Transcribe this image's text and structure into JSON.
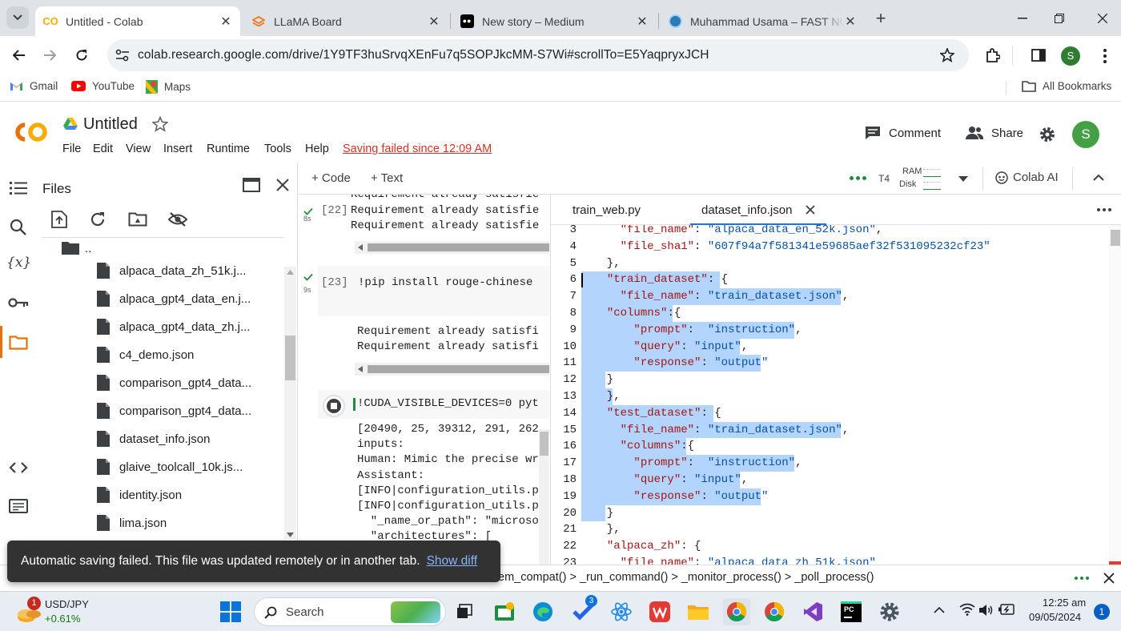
{
  "browser": {
    "tabs": [
      {
        "title": "Untitled - Colab",
        "icon": "colab-icon"
      },
      {
        "title": "LLaMA Board",
        "icon": "gradio-icon"
      },
      {
        "title": "New story – Medium",
        "icon": "medium-icon"
      },
      {
        "title": "Muhammad Usama – FAST NUC",
        "icon": "fast-nu-icon"
      }
    ],
    "url": "colab.research.google.com/drive/1Y9TF3huSrvqXEnFu7q5SOPJkcMM-S7Wi#scrollTo=E5YaqpryxJCH",
    "profile_initial": "S",
    "bookmarks": [
      "Gmail",
      "YouTube",
      "Maps"
    ],
    "all_bookmarks": "All Bookmarks"
  },
  "colab": {
    "logo": "CO",
    "title": "Untitled",
    "menus": [
      "File",
      "Edit",
      "View",
      "Insert",
      "Runtime",
      "Tools",
      "Help"
    ],
    "saving_status": "Saving failed since 12:09 AM",
    "comment_label": "Comment",
    "share_label": "Share",
    "avatar_initial": "S",
    "add_code": "+ Code",
    "add_text": "+ Text",
    "runtime": "T4",
    "ram_label": "RAM",
    "disk_label": "Disk",
    "colab_ai": "Colab AI"
  },
  "files_panel": {
    "title": "Files",
    "parent": "..",
    "items": [
      "alpaca_data_zh_51k.j...",
      "alpaca_gpt4_data_en.j...",
      "alpaca_gpt4_data_zh.j...",
      "c4_demo.json",
      "comparison_gpt4_data...",
      "comparison_gpt4_data...",
      "dataset_info.json",
      "glaive_toolcall_10k.js...",
      "identity.json",
      "lima.json"
    ]
  },
  "notebook": {
    "cell22": {
      "exec_count": "[22]",
      "time": "8s",
      "output_top": "Requirement already satisfie",
      "output": [
        "Requirement already satisfie",
        "Requirement already satisfie"
      ]
    },
    "cell23": {
      "exec_count": "[23]",
      "time": "9s",
      "code": "!pip install rouge-chinese",
      "output": [
        "Requirement already satisfi",
        "Requirement already satisfi"
      ]
    },
    "cell24": {
      "code": "!CUDA_VISIBLE_DEVICES=0 pyt",
      "output": [
        "[20490, 25, 39312, 291, 262",
        "inputs:",
        "Human: Mimic the precise wr",
        "Assistant:",
        "[INFO|configuration_utils.p",
        "[INFO|configuration_utils.p",
        "  \"_name_or_path\": \"microso",
        "  \"architectures\": ["
      ]
    }
  },
  "editor": {
    "tabs": [
      "train_web.py",
      "dataset_info.json"
    ],
    "lines": [
      {
        "n": "3",
        "code": "    \"file_name\": \"alpaca_data_en_52k.json\","
      },
      {
        "n": "4",
        "code": "    \"file_sha1\": \"607f94a7f581341e59685aef32f531095232cf23\""
      },
      {
        "n": "5",
        "code": "  },"
      },
      {
        "n": "6",
        "code": "  \"train_dataset\": {"
      },
      {
        "n": "7",
        "code": "    \"file_name\": \"train_dataset.json\","
      },
      {
        "n": "8",
        "code": "  \"columns\":{"
      },
      {
        "n": "9",
        "code": "      \"prompt\":  \"instruction\","
      },
      {
        "n": "10",
        "code": "      \"query\": \"input\","
      },
      {
        "n": "11",
        "code": "      \"response\": \"output\""
      },
      {
        "n": "12",
        "code": "  }"
      },
      {
        "n": "13",
        "code": "  },"
      },
      {
        "n": "14",
        "code": "  \"test_dataset\": {"
      },
      {
        "n": "15",
        "code": "    \"file_name\": \"train_dataset.json\","
      },
      {
        "n": "16",
        "code": "    \"columns\":{"
      },
      {
        "n": "17",
        "code": "      \"prompt\":  \"instruction\","
      },
      {
        "n": "18",
        "code": "      \"query\": \"input\","
      },
      {
        "n": "19",
        "code": "      \"response\": \"output\""
      },
      {
        "n": "20",
        "code": "  }"
      },
      {
        "n": "21",
        "code": "  },"
      },
      {
        "n": "22",
        "code": "  \"alpaca_zh\": {"
      },
      {
        "n": "23",
        "code": "    \"file_name\": \"alpaca_data_zh_51k.json\""
      }
    ]
  },
  "statusbar": {
    "trace": "em_compat() > _run_command() > _monitor_process() > _poll_process()"
  },
  "toast": {
    "message": "Automatic saving failed. This file was updated remotely or in another tab.",
    "action": "Show diff"
  },
  "taskbar": {
    "stock_badge": "1",
    "stock_name": "USD/JPY",
    "stock_change": "+0.61%",
    "search_placeholder": "Search",
    "vscode_badge": "3",
    "time": "12:25 am",
    "date": "09/05/2024",
    "notif_badge": "1"
  },
  "colors": {
    "accent_orange": "#f9ab00",
    "error_red": "#d93025",
    "selection": "#b3d4fc",
    "link_blue": "#8ab4f8"
  }
}
